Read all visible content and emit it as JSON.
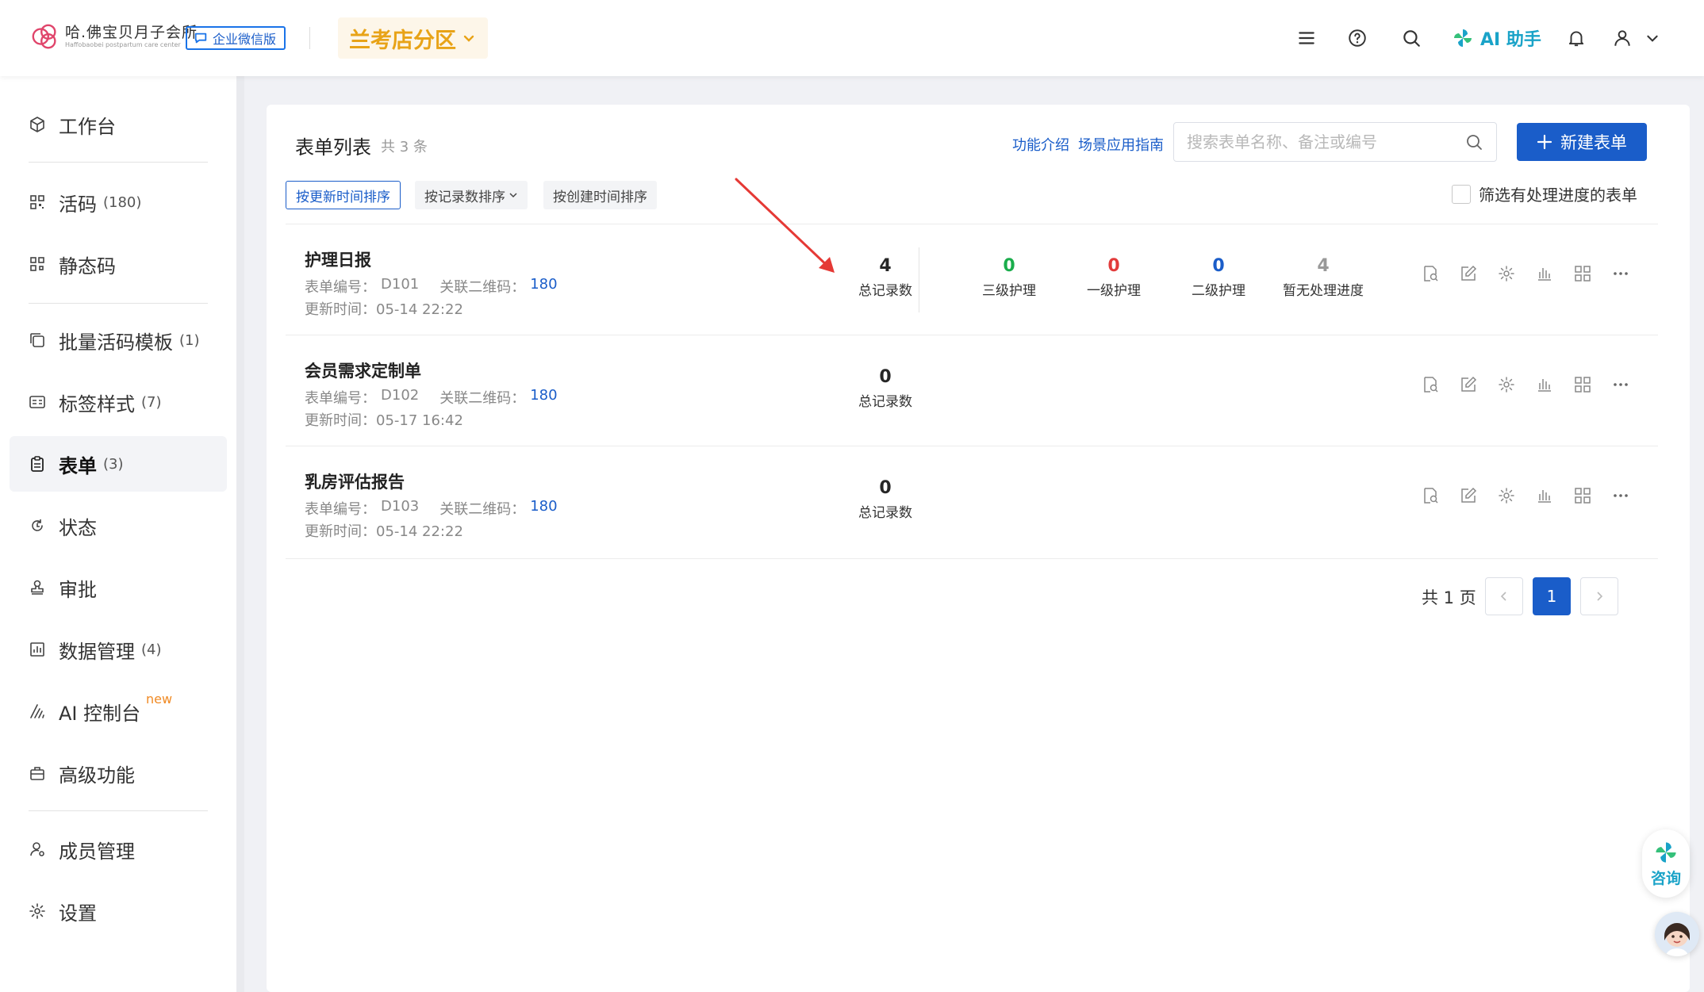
{
  "header": {
    "logo_cn": "哈.佛宝贝月子会所",
    "logo_en": "Haffobaobei postpartum care center",
    "wechat_badge": "企业微信版",
    "store_name": "兰考店分区",
    "ai_assistant": "AI 助手",
    "brand_color": "#1a5dc9",
    "store_color": "#e8a317"
  },
  "sidebar": {
    "items": [
      {
        "label": "工作台",
        "count": ""
      },
      {
        "label": "活码",
        "count": "(180)"
      },
      {
        "label": "静态码",
        "count": ""
      },
      {
        "label": "批量活码模板",
        "count": "(1)"
      },
      {
        "label": "标签样式",
        "count": "(7)"
      },
      {
        "label": "表单",
        "count": "(3)"
      },
      {
        "label": "状态",
        "count": ""
      },
      {
        "label": "审批",
        "count": ""
      },
      {
        "label": "数据管理",
        "count": "(4)"
      },
      {
        "label": "AI 控制台",
        "count": "",
        "badge": "new"
      },
      {
        "label": "高级功能",
        "count": ""
      },
      {
        "label": "成员管理",
        "count": ""
      },
      {
        "label": "设置",
        "count": ""
      }
    ],
    "active_index": 5
  },
  "main": {
    "title": "表单列表",
    "total": "共 3 条",
    "link_intro": "功能介绍",
    "link_guide": "场景应用指南",
    "search_placeholder": "搜索表单名称、备注或编号",
    "new_button": "新建表单",
    "sort_buttons": [
      "按更新时间排序",
      "按记录数排序",
      "按创建时间排序"
    ],
    "filter_label": "筛选有处理进度的表单",
    "forms": [
      {
        "name": "护理日报",
        "code_label": "表单编号：",
        "code": "D101",
        "qr_label": "关联二维码：",
        "qr_count": "180",
        "updated_label": "更新时间：",
        "updated": "05-14 22:22",
        "total_records": "4",
        "total_label": "总记录数",
        "progress": [
          {
            "value": "0",
            "label": "三级护理",
            "color": "#1aad4c"
          },
          {
            "value": "0",
            "label": "一级护理",
            "color": "#e23b3b"
          },
          {
            "value": "0",
            "label": "二级护理",
            "color": "#1a5dc9"
          },
          {
            "value": "4",
            "label": "暂无处理进度",
            "color": "#999999"
          }
        ]
      },
      {
        "name": "会员需求定制单",
        "code_label": "表单编号：",
        "code": "D102",
        "qr_label": "关联二维码：",
        "qr_count": "180",
        "updated_label": "更新时间：",
        "updated": "05-17 16:42",
        "total_records": "0",
        "total_label": "总记录数",
        "progress": []
      },
      {
        "name": "乳房评估报告",
        "code_label": "表单编号：",
        "code": "D103",
        "qr_label": "关联二维码：",
        "qr_count": "180",
        "updated_label": "更新时间：",
        "updated": "05-14 22:22",
        "total_records": "0",
        "total_label": "总记录数",
        "progress": []
      }
    ],
    "row_actions": [
      "preview-icon",
      "edit-icon",
      "settings-icon",
      "chart-icon",
      "qrcode-icon",
      "more-icon"
    ],
    "pager": {
      "total_pages": "共 1 页",
      "current": "1"
    }
  },
  "floating": {
    "consult": "咨询"
  }
}
